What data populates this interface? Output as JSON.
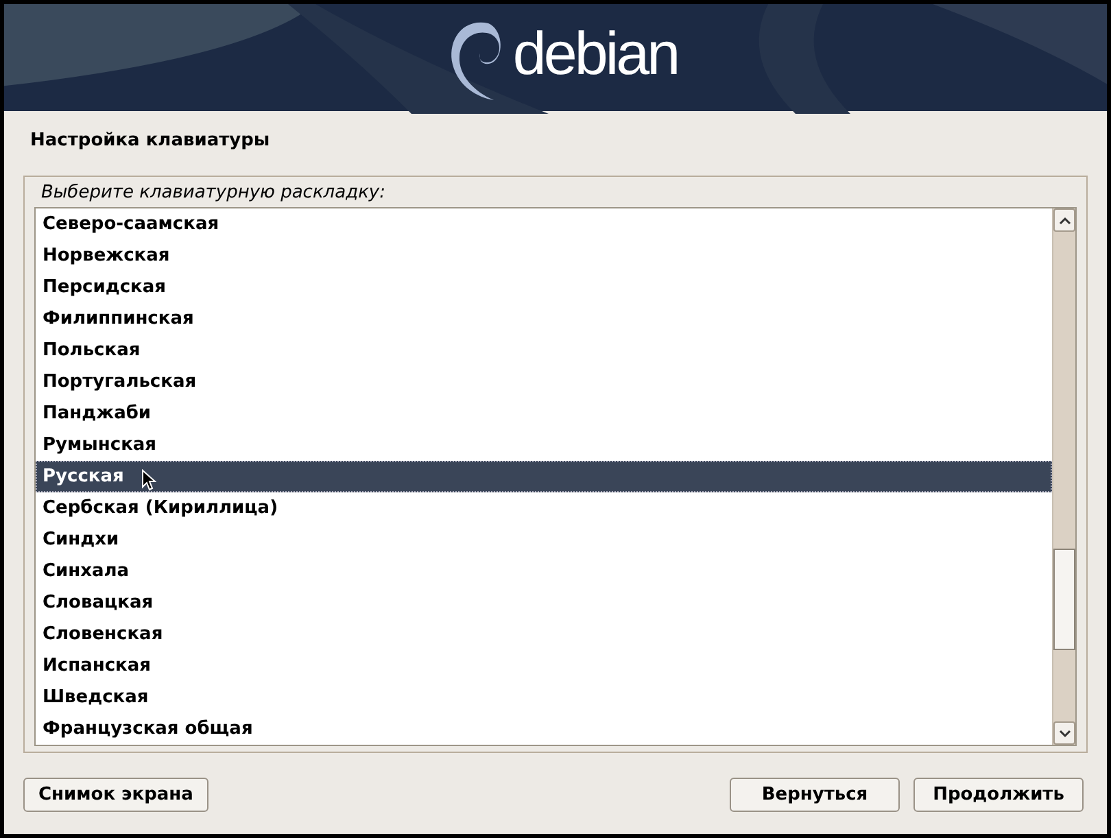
{
  "banner": {
    "logo_text": "debian"
  },
  "title": "Настройка клавиатуры",
  "prompt": "Выберите клавиатурную раскладку:",
  "layouts": [
    {
      "label": "Северо-саамская",
      "selected": false
    },
    {
      "label": "Норвежская",
      "selected": false
    },
    {
      "label": "Персидская",
      "selected": false
    },
    {
      "label": "Филиппинская",
      "selected": false
    },
    {
      "label": "Польская",
      "selected": false
    },
    {
      "label": "Португальская",
      "selected": false
    },
    {
      "label": "Панджаби",
      "selected": false
    },
    {
      "label": "Румынская",
      "selected": false
    },
    {
      "label": "Русская",
      "selected": true
    },
    {
      "label": "Сербская (Кириллица)",
      "selected": false
    },
    {
      "label": "Синдхи",
      "selected": false
    },
    {
      "label": "Синхала",
      "selected": false
    },
    {
      "label": "Словацкая",
      "selected": false
    },
    {
      "label": "Словенская",
      "selected": false
    },
    {
      "label": "Испанская",
      "selected": false
    },
    {
      "label": "Шведская",
      "selected": false
    },
    {
      "label": "Французская общая",
      "selected": false
    }
  ],
  "buttons_left": [
    "Снимок экрана"
  ],
  "buttons_right": [
    "Вернуться",
    "Продолжить"
  ]
}
